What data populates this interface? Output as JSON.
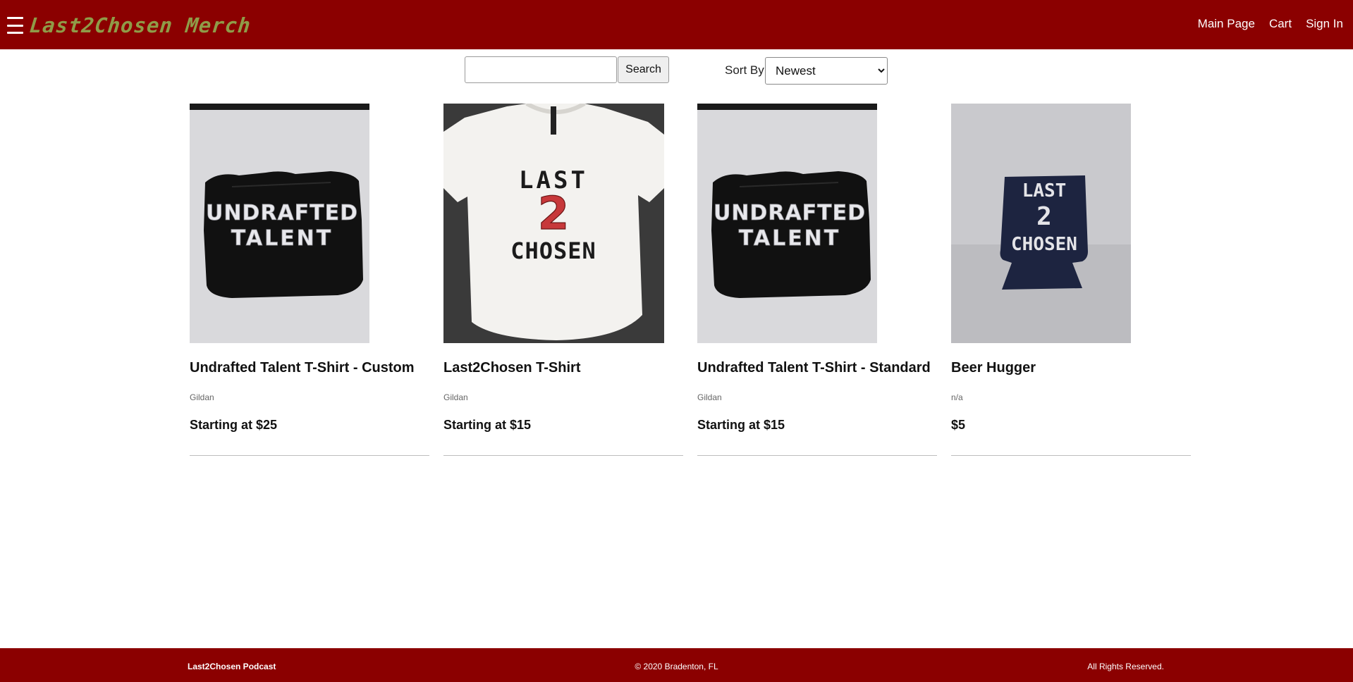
{
  "header": {
    "brand": "Last2Chosen Merch",
    "nav": [
      "Main Page",
      "Cart",
      "Sign In"
    ],
    "background": "#8b0000",
    "brand_color": "#8f9c48"
  },
  "search": {
    "value": "",
    "button_label": "Search"
  },
  "sort": {
    "label": "Sort By",
    "selected": "Newest"
  },
  "products": [
    {
      "name": "Undrafted Talent T-Shirt - Custom",
      "brand": "Gildan",
      "price": "Starting at $25",
      "image_text": [
        "UNDRAFTED",
        "TALENT"
      ],
      "image": "black-tshirt-folded"
    },
    {
      "name": "Last2Chosen T-Shirt",
      "brand": "Gildan",
      "price": "Starting at $15",
      "image_text": [
        "LAST",
        "2",
        "CHOSEN"
      ],
      "image": "white-tshirt"
    },
    {
      "name": "Undrafted Talent T-Shirt - Standard",
      "brand": "Gildan",
      "price": "Starting at $15",
      "image_text": [
        "UNDRAFTED",
        "TALENT"
      ],
      "image": "black-tshirt-folded"
    },
    {
      "name": "Beer Hugger",
      "brand": "n/a",
      "price": "$5",
      "image_text": [
        "LAST",
        "2",
        "CHOSEN"
      ],
      "image": "navy-koozie"
    }
  ],
  "footer": {
    "left": "Last2Chosen Podcast",
    "center": "© 2020 Bradenton, FL",
    "right": "All Rights Reserved.",
    "background": "#8b0000"
  }
}
